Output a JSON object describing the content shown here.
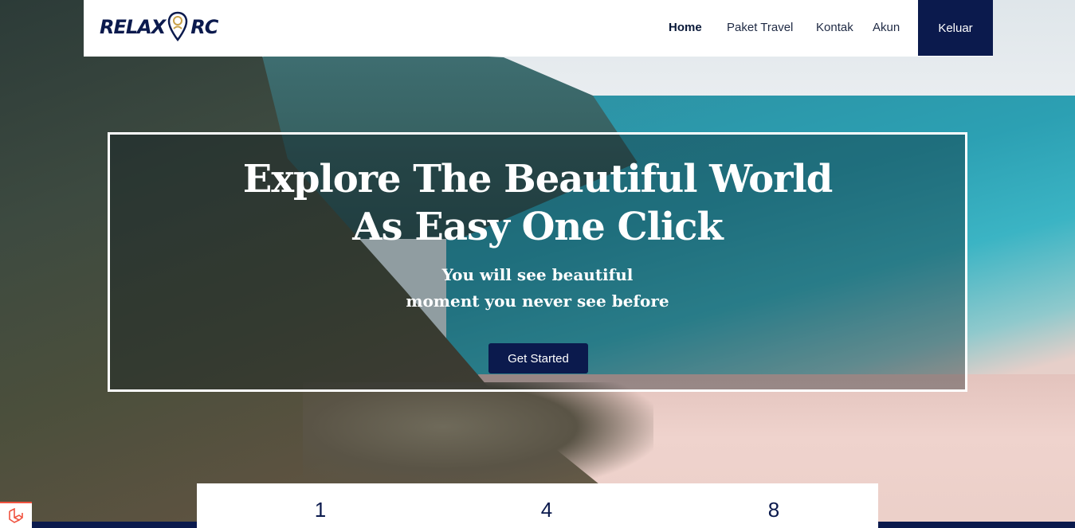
{
  "navbar": {
    "logo_text_left": "RELAX",
    "logo_text_right": "RC",
    "links": [
      {
        "label": "Home",
        "active": true
      },
      {
        "label": "Paket Travel",
        "active": false
      },
      {
        "label": "Kontak",
        "active": false
      },
      {
        "label": "Akun",
        "active": false
      }
    ],
    "logout_label": "Keluar"
  },
  "hero": {
    "title_line1": "Explore The Beautiful World",
    "title_line2": "As Easy One Click",
    "subtitle_line1": "You will see beautiful",
    "subtitle_line2": "moment you never see before",
    "cta_label": "Get Started"
  },
  "stats": {
    "values": [
      "1",
      "4",
      "8"
    ]
  },
  "colors": {
    "brand_navy": "#0b1a4d",
    "white": "#ffffff",
    "laravel_red": "#f05340"
  },
  "icons": {
    "logo_pin": "map-pin-icon",
    "debug_badge": "laravel-icon"
  }
}
